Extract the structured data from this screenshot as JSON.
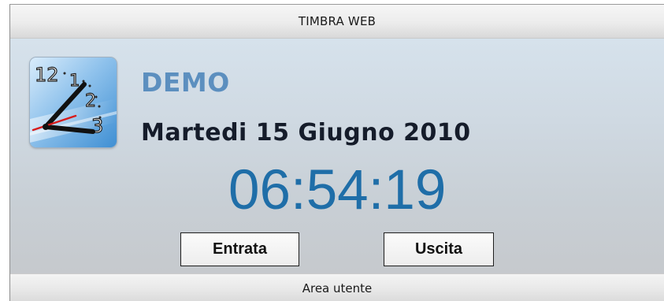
{
  "header": {
    "title": "TIMBRA WEB"
  },
  "main": {
    "company_name": "DEMO",
    "date": "Martedi 15 Giugno 2010",
    "time": "06:54:19",
    "clock_icon": "analog-clock-icon"
  },
  "actions": {
    "entrata_label": "Entrata",
    "uscita_label": "Uscita"
  },
  "footer": {
    "label": "Area utente"
  },
  "colors": {
    "company": "#5c8fbf",
    "time": "#1f6ea8",
    "date": "#151c2a"
  }
}
